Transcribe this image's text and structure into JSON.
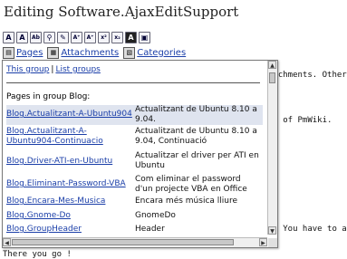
{
  "title": "Editing Software.AjaxEditSupport",
  "toolbar": {
    "buttons": [
      {
        "icon": "text-large-icon",
        "glyph": "A"
      },
      {
        "icon": "text-small-icon",
        "glyph": "A"
      },
      {
        "icon": "text-ab-icon",
        "glyph": "Ab"
      },
      {
        "icon": "link-icon",
        "glyph": "⚲"
      },
      {
        "icon": "pencil-icon",
        "glyph": "✎"
      },
      {
        "icon": "superscript-big-icon",
        "glyph": "A⁺"
      },
      {
        "icon": "superscript-icon",
        "glyph": "A⁺"
      },
      {
        "icon": "x-sup-icon",
        "glyph": "x²"
      },
      {
        "icon": "x-sub-icon",
        "glyph": "x₂"
      },
      {
        "icon": "bold-a-icon",
        "glyph": "A"
      },
      {
        "icon": "square-icon",
        "glyph": "▣"
      }
    ]
  },
  "tabs": [
    {
      "label": "Pages",
      "icon": "pages-icon"
    },
    {
      "label": "Attachments",
      "icon": "attachments-icon"
    },
    {
      "label": "Categories",
      "icon": "categories-icon"
    }
  ],
  "background_text": {
    "line1": "tachments. Other c",
    "line2": "on of PmWiki.",
    "line3": "). You have to ad",
    "line4": "There you go !"
  },
  "popup": {
    "link_group": "This group",
    "separator": "|",
    "link_list": "List groups",
    "heading": "Pages in group Blog:",
    "rows": [
      {
        "page": "Blog.Actualitzant-A-Ubuntu904",
        "desc": "Actualitzant de Ubuntu 8.10 a 9.04."
      },
      {
        "page": "Blog.Actualitzant-A-Ubuntu904-Continuacio",
        "desc": "Actualitzant de Ubuntu 8.10 a 9.04, Continuació"
      },
      {
        "page": "Blog.Driver-ATI-en-Ubuntu",
        "desc": "Actualitzar el driver per ATI en Ubuntu"
      },
      {
        "page": "Blog.Eliminant-Password-VBA",
        "desc": "Com eliminar el password d'un projecte VBA en Office"
      },
      {
        "page": "Blog.Encara-Mes-Musica",
        "desc": "Encara més música lliure"
      },
      {
        "page": "Blog.Gnome-Do",
        "desc": "GnomeDo"
      },
      {
        "page": "Blog.GroupHeader",
        "desc": "Header"
      }
    ]
  }
}
